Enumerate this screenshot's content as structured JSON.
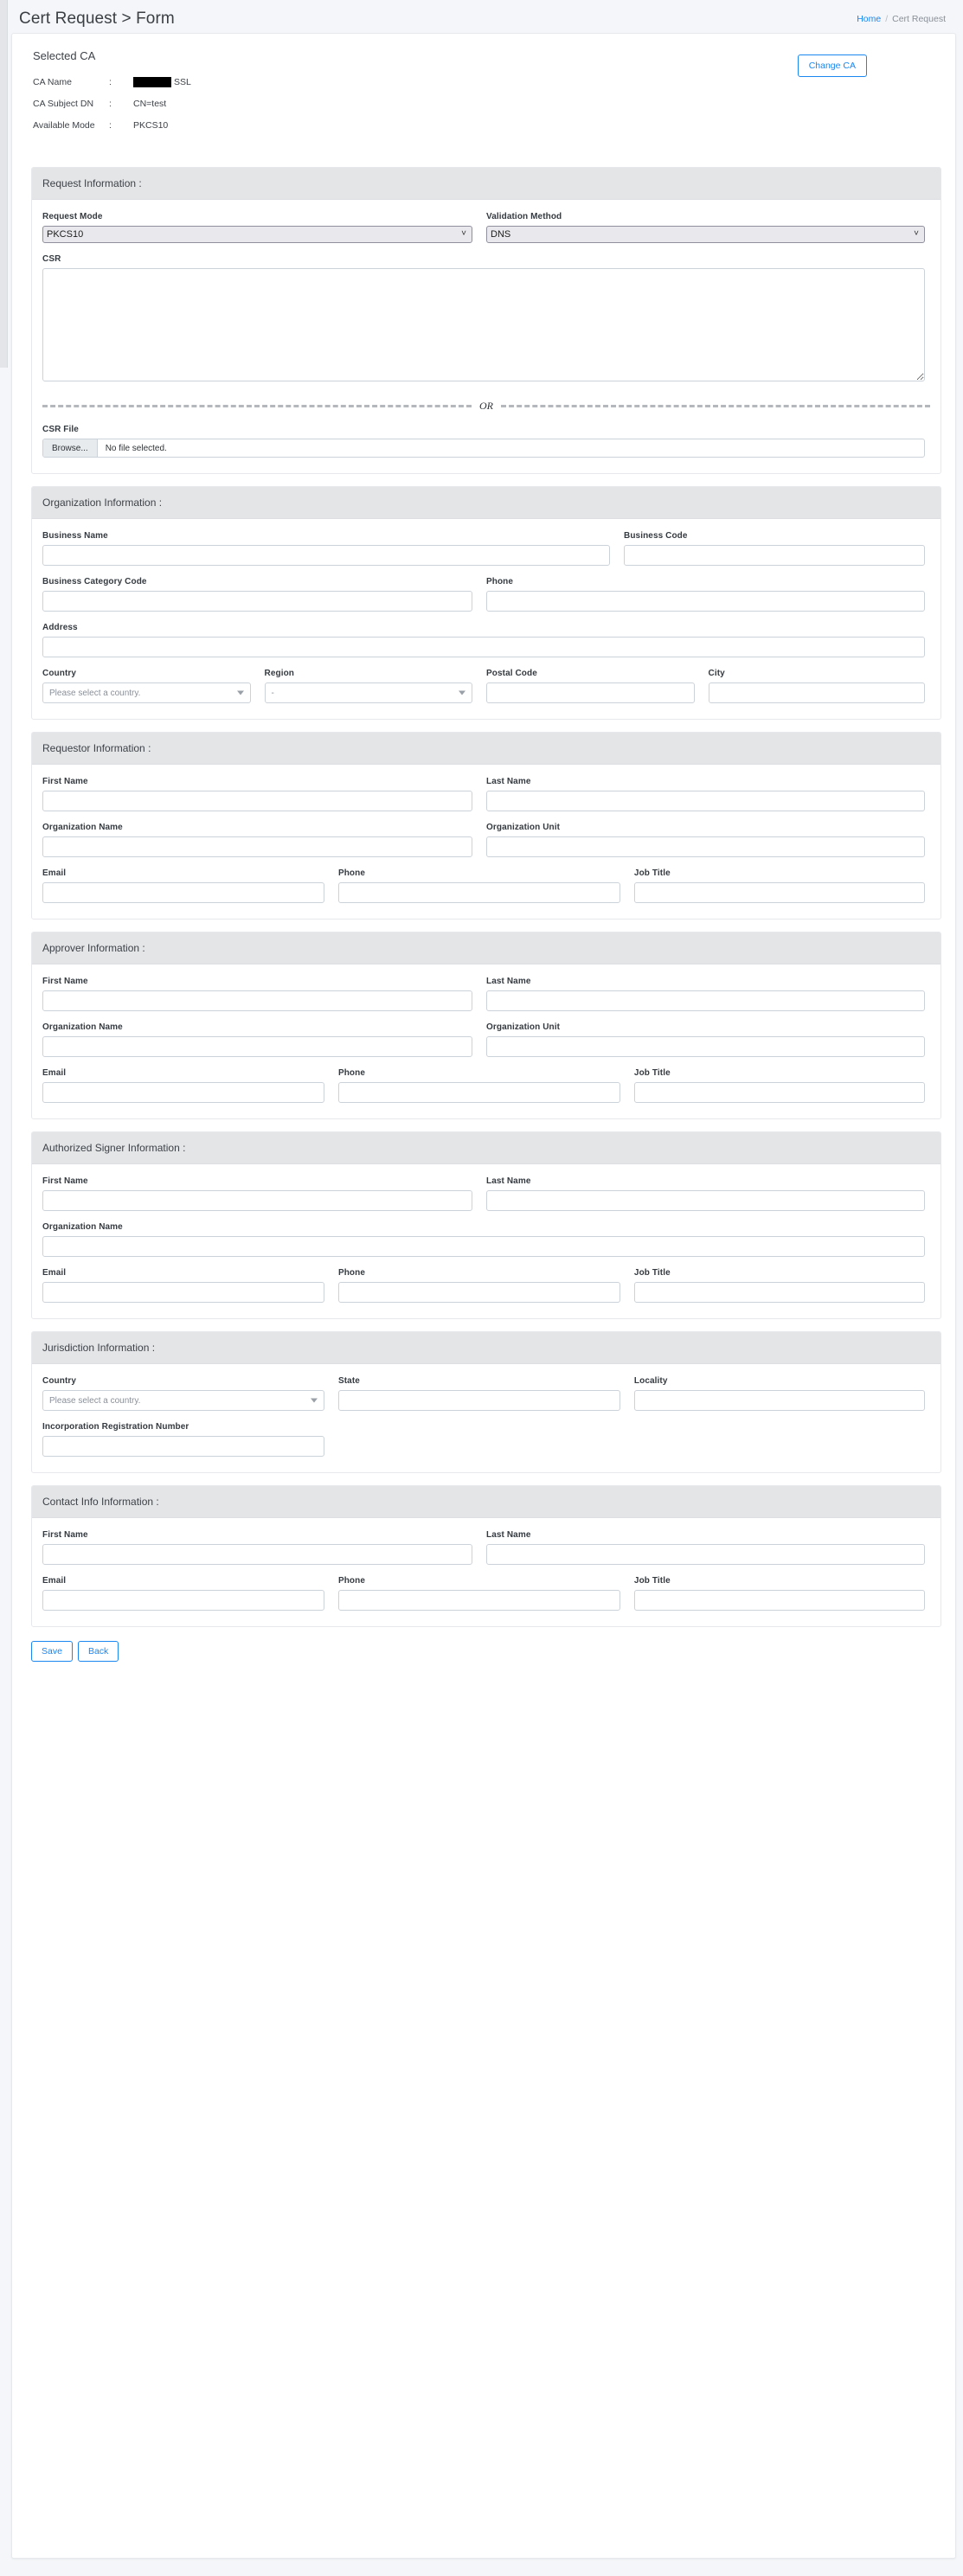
{
  "header": {
    "title": "Cert Request > Form",
    "breadcrumb": {
      "home": "Home",
      "separator": "/",
      "current": "Cert Request"
    }
  },
  "selected_ca": {
    "heading": "Selected CA",
    "colon": ":",
    "change_button": "Change CA",
    "rows": [
      {
        "label": "CA Name",
        "value": "SSL",
        "redacted": true
      },
      {
        "label": "CA Subject DN",
        "value": "CN=test",
        "redacted": false
      },
      {
        "label": "Available Mode",
        "value": "PKCS10",
        "redacted": false
      }
    ]
  },
  "request_information": {
    "title": "Request Information :",
    "request_mode": {
      "label": "Request Mode",
      "value": "PKCS10"
    },
    "validation_method": {
      "label": "Validation Method",
      "value": "DNS"
    },
    "csr": {
      "label": "CSR",
      "value": ""
    },
    "or_text": "OR",
    "csr_file": {
      "label": "CSR File",
      "browse": "Browse...",
      "filename": "No file selected."
    }
  },
  "organization_information": {
    "title": "Organization Information :",
    "business_name": {
      "label": "Business Name",
      "value": ""
    },
    "business_code": {
      "label": "Business Code",
      "value": ""
    },
    "business_category_code": {
      "label": "Business Category Code",
      "value": ""
    },
    "phone": {
      "label": "Phone",
      "value": ""
    },
    "address": {
      "label": "Address",
      "value": ""
    },
    "country": {
      "label": "Country",
      "value": "Please select a country."
    },
    "region": {
      "label": "Region",
      "value": "-"
    },
    "postal_code": {
      "label": "Postal Code",
      "value": ""
    },
    "city": {
      "label": "City",
      "value": ""
    }
  },
  "requestor_information": {
    "title": "Requestor Information :",
    "first_name": {
      "label": "First Name",
      "value": ""
    },
    "last_name": {
      "label": "Last Name",
      "value": ""
    },
    "organization_name": {
      "label": "Organization Name",
      "value": ""
    },
    "organization_unit": {
      "label": "Organization Unit",
      "value": ""
    },
    "email": {
      "label": "Email",
      "value": ""
    },
    "phone": {
      "label": "Phone",
      "value": ""
    },
    "job_title": {
      "label": "Job Title",
      "value": ""
    }
  },
  "approver_information": {
    "title": "Approver Information :",
    "first_name": {
      "label": "First Name",
      "value": ""
    },
    "last_name": {
      "label": "Last Name",
      "value": ""
    },
    "organization_name": {
      "label": "Organization Name",
      "value": ""
    },
    "organization_unit": {
      "label": "Organization Unit",
      "value": ""
    },
    "email": {
      "label": "Email",
      "value": ""
    },
    "phone": {
      "label": "Phone",
      "value": ""
    },
    "job_title": {
      "label": "Job Title",
      "value": ""
    }
  },
  "authorized_signer_information": {
    "title": "Authorized Signer Information :",
    "first_name": {
      "label": "First Name",
      "value": ""
    },
    "last_name": {
      "label": "Last Name",
      "value": ""
    },
    "organization_name": {
      "label": "Organization Name",
      "value": ""
    },
    "email": {
      "label": "Email",
      "value": ""
    },
    "phone": {
      "label": "Phone",
      "value": ""
    },
    "job_title": {
      "label": "Job Title",
      "value": ""
    }
  },
  "jurisdiction_information": {
    "title": "Jurisdiction Information :",
    "country": {
      "label": "Country",
      "value": "Please select a country."
    },
    "state": {
      "label": "State",
      "value": ""
    },
    "locality": {
      "label": "Locality",
      "value": ""
    },
    "incorporation_registration_number": {
      "label": "Incorporation Registration Number",
      "value": ""
    }
  },
  "contact_info_information": {
    "title": "Contact Info Information :",
    "first_name": {
      "label": "First Name",
      "value": ""
    },
    "last_name": {
      "label": "Last Name",
      "value": ""
    },
    "email": {
      "label": "Email",
      "value": ""
    },
    "phone": {
      "label": "Phone",
      "value": ""
    },
    "job_title": {
      "label": "Job Title",
      "value": ""
    }
  },
  "actions": {
    "save": "Save",
    "back": "Back"
  },
  "colors": {
    "accent": "#1a86f0",
    "section_header_bg": "#e4e5e7",
    "page_bg": "#f4f6f9",
    "border": "#ccd2d9"
  }
}
